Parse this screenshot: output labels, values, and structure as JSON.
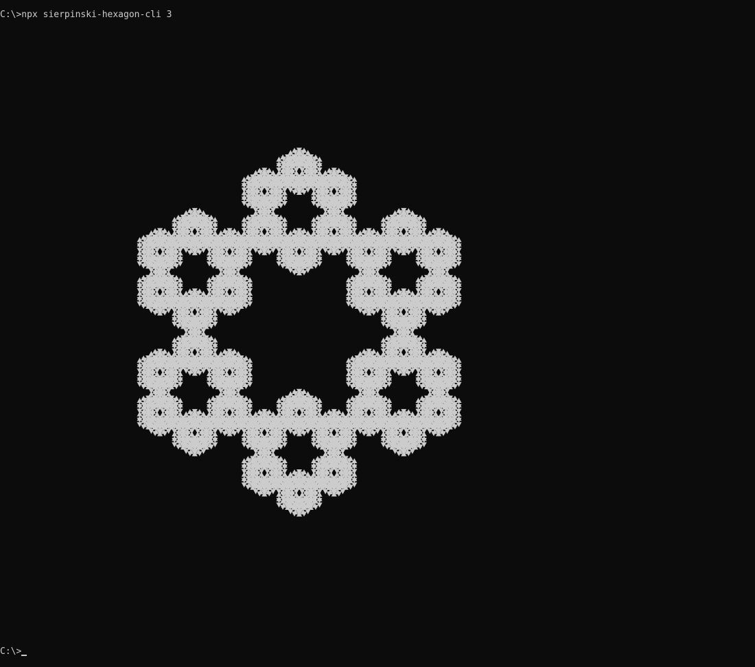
{
  "terminal": {
    "command_line": "C:\\>npx sierpinski-hexagon-cli 3",
    "prompt_line": "C:\\>",
    "background_color": "#0c0c0c",
    "foreground_color": "#cccccc"
  },
  "fractal": {
    "name": "sierpinski-hexagon",
    "depth": 3,
    "glyph_up": "▲",
    "glyph_down": "▼",
    "glyph_color": "#cccccc"
  }
}
